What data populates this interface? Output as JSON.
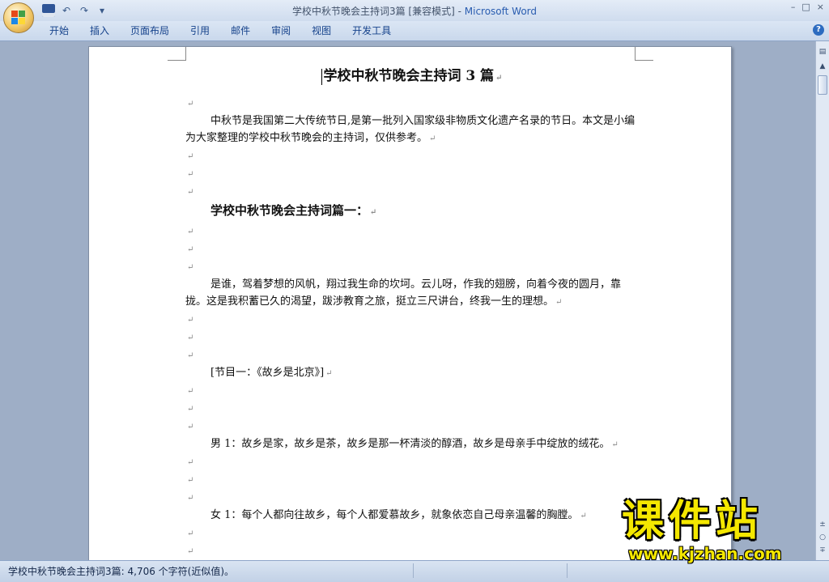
{
  "window": {
    "title": "学校中秋节晚会主持词3篇 [兼容模式]",
    "title_separator": " - ",
    "app_name": "Microsoft Word",
    "minimize_glyph": "–",
    "maximize_glyph": "□",
    "close_glyph": "×"
  },
  "quick_access": {
    "undo_glyph": "↶",
    "redo_glyph": "↷",
    "customize_glyph": "▾"
  },
  "ribbon": {
    "tabs": [
      "开始",
      "插入",
      "页面布局",
      "引用",
      "邮件",
      "审阅",
      "视图",
      "开发工具"
    ],
    "help_glyph": "?"
  },
  "document": {
    "paragraph_mark": "↵",
    "title": "学校中秋节晚会主持词 3 篇",
    "intro": "中秋节是我国第二大传统节日,是第一批列入国家级非物质文化遗产名录的节日。本文是小编为大家整理的学校中秋节晚会的主持词，仅供参考。",
    "heading1": "学校中秋节晚会主持词篇一：",
    "para1": "是谁，驾着梦想的风帆，翔过我生命的坎坷。云儿呀，作我的翅膀，向着今夜的圆月，靠拢。这是我积蓄已久的渴望，跋涉教育之旅，挺立三尺讲台，终我一生的理想。",
    "program1": "[节目一：《故乡是北京》]",
    "male1": "男 1：故乡是家，故乡是茶，故乡是那一杯清淡的醇酒，故乡是母亲手中绽放的绒花。",
    "female1": "女 1：每个人都向往故乡，每个人都爱慕故乡，就象依恋自己母亲温馨的胸膛。"
  },
  "scrollbar": {
    "up_glyph": "▲",
    "prev_glyph": "±",
    "select_glyph": "○",
    "next_glyph": "∓"
  },
  "status": {
    "text": "学校中秋节晚会主持词3篇: 4,706 个字符(近似值)。"
  },
  "watermark": {
    "cn": "课件站",
    "url": "www.kjzhan.com"
  },
  "colors": {
    "ribbon_text": "#15428b",
    "app_name": "#2a5db0",
    "watermark": "#f4e700"
  }
}
